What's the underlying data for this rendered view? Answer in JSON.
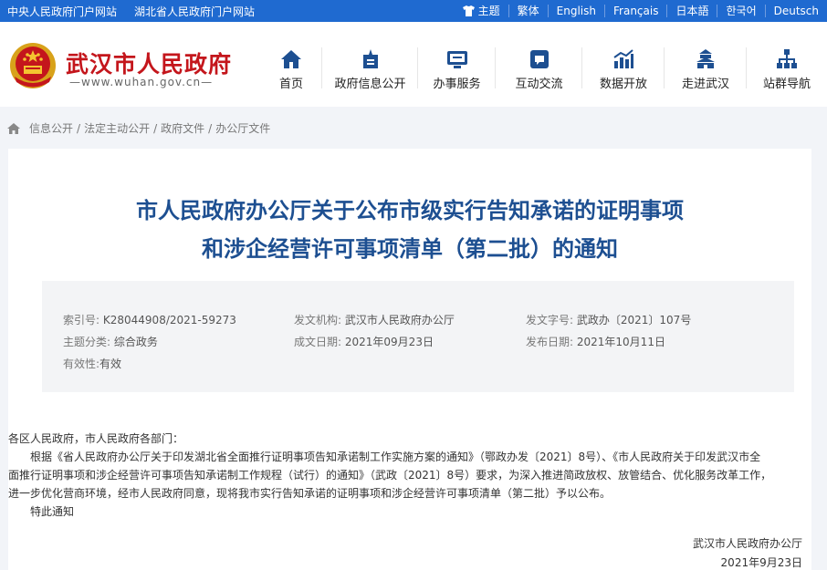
{
  "topbar": {
    "link_central": "中央人民政府门户网站",
    "link_hubei": "湖北省人民政府门户网站",
    "theme": "主题",
    "lang_trad": "繁体",
    "lang_en": "English",
    "lang_fr": "Français",
    "lang_jp": "日本語",
    "lang_kr": "한국어",
    "lang_de": "Deutsch"
  },
  "header": {
    "site_name": "武汉市人民政府",
    "site_url": "—www.wuhan.gov.cn—",
    "nav": [
      {
        "label": "首页",
        "icon": "home-icon"
      },
      {
        "label": "政府信息公开",
        "icon": "info-disclosure-icon"
      },
      {
        "label": "办事服务",
        "icon": "service-icon"
      },
      {
        "label": "互动交流",
        "icon": "interaction-icon"
      },
      {
        "label": "数据开放",
        "icon": "data-open-icon"
      },
      {
        "label": "走进武汉",
        "icon": "city-gate-icon"
      },
      {
        "label": "站群导航",
        "icon": "sitemap-icon"
      }
    ]
  },
  "breadcrumb": [
    "信息公开",
    "/",
    "法定主动公开",
    "/",
    "政府文件",
    "/",
    "办公厅文件"
  ],
  "article": {
    "title_line1": "市人民政府办公厅关于公布市级实行告知承诺的证明事项",
    "title_line2": "和涉企经营许可事项清单（第二批）的通知",
    "meta": {
      "index_label": "索引号:",
      "index_value": "K28044908/2021-59273",
      "issuer_label": "发文机构:",
      "issuer_value": "武汉市人民政府办公厅",
      "docno_label": "发文字号:",
      "docno_value": "武政办〔2021〕107号",
      "topic_label": "主题分类:",
      "topic_value": "综合政务",
      "created_label": "成文日期:",
      "created_value": "2021年09月23日",
      "published_label": "发布日期:",
      "published_value": "2021年10月11日",
      "validity_label": "有效性:",
      "validity_value": "有效"
    },
    "body": [
      "各区人民政府，市人民政府各部门：",
      "　　根据《省人民政府办公厅关于印发湖北省全面推行证明事项告知承诺制工作实施方案的通知》（鄂政办发〔2021〕8号）、《市人民政府关于印发武汉市全",
      "面推行证明事项和涉企经营许可事项告知承诺制工作规程（试行）的通知》（武政〔2021〕8号）要求，为深入推进简政放权、放管结合、优化服务改革工作，",
      "进一步优化营商环境，经市人民政府同意，现将我市实行告知承诺的证明事项和涉企经营许可事项清单（第二批）予以公布。",
      "　　特此通知"
    ],
    "signature": "武汉市人民政府办公厅",
    "sign_date": "2021年9月23日"
  },
  "colors": {
    "topbar": "#1f6ad0",
    "brand_red": "#c4161c",
    "title_blue": "#1d4f91"
  }
}
